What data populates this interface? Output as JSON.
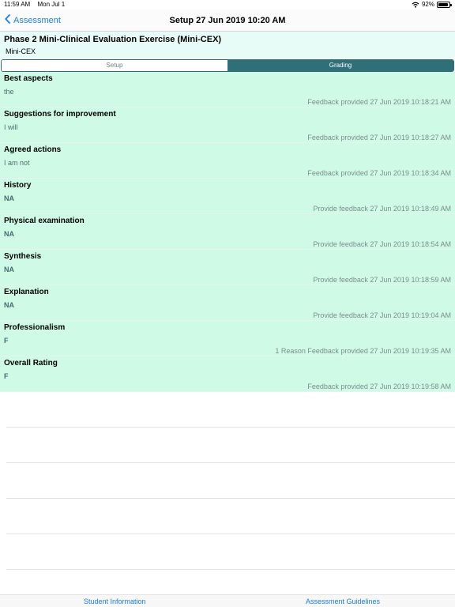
{
  "status": {
    "time": "11:59 AM",
    "date": "Mon Jul 1",
    "battery": "92%"
  },
  "nav": {
    "back_label": "Assessment",
    "title": "Setup 27 Jun 2019 10:20 AM"
  },
  "header": {
    "title": "Phase 2 Mini-Clinical Evaluation Exercise (Mini-CEX)",
    "subtitle": "Mini-CEX"
  },
  "segments": [
    {
      "label": "Setup",
      "active": false
    },
    {
      "label": "Grading",
      "active": true
    }
  ],
  "rows": [
    {
      "title": "Best aspects",
      "value": "the",
      "meta": "Feedback provided 27 Jun 2019 10:18:21 AM"
    },
    {
      "title": "Suggestions for improvement",
      "value": "I will",
      "meta": "Feedback provided 27 Jun 2019 10:18:27 AM"
    },
    {
      "title": "Agreed actions",
      "value": "I am not",
      "meta": "Feedback provided 27 Jun 2019 10:18:34 AM"
    },
    {
      "title": "History",
      "value": "NA",
      "meta": "Provide feedback 27 Jun 2019 10:18:49 AM"
    },
    {
      "title": "Physical examination",
      "value": "NA",
      "meta": "Provide feedback 27 Jun 2019 10:18:54 AM"
    },
    {
      "title": "Synthesis",
      "value": "NA",
      "meta": "Provide feedback 27 Jun 2019 10:18:59 AM"
    },
    {
      "title": "Explanation",
      "value": "NA",
      "meta": "Provide feedback 27 Jun 2019 10:19:04 AM"
    },
    {
      "title": "Professionalism",
      "value": "F",
      "meta": "1 Reason Feedback provided 27 Jun 2019 10:19:35 AM"
    },
    {
      "title": "Overall Rating",
      "value": "F",
      "meta": "Feedback provided 27 Jun 2019 10:19:58 AM"
    }
  ],
  "tabs": {
    "left": "Student Information",
    "right": "Assessment Guidelines"
  },
  "colors": {
    "accent": "#1a7cf5",
    "header_bg": "#e8fcf7",
    "list_bg": "#cffbe6",
    "segment_active": "#2f6f78"
  },
  "battery_level": 0.92
}
